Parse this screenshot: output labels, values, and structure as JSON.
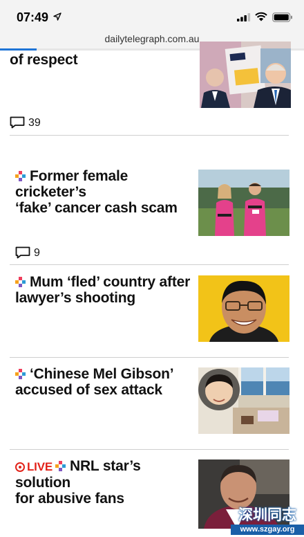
{
  "status_bar": {
    "time": "07:49"
  },
  "browser": {
    "url": "dailytelegraph.com.au",
    "load_progress": 0.12
  },
  "articles": [
    {
      "title_lines": [
        "of respect"
      ],
      "comments": "39",
      "thumb": "sports-montage"
    },
    {
      "title_lines": [
        "Former female cricketer’s",
        "‘fake’ cancer cash scam"
      ],
      "comments": "9",
      "thumb": "cricketers"
    },
    {
      "title_lines": [
        "Mum ‘fled’ country after",
        "lawyer’s shooting"
      ],
      "thumb": "smiling-man"
    },
    {
      "title_lines": [
        "‘Chinese Mel Gibson’",
        "accused of sex attack"
      ],
      "thumb": "mansion"
    },
    {
      "title_lines": [
        "NRL star’s solution",
        "for abusive fans"
      ],
      "live_label": "LIVE",
      "thumb": "nrl-player"
    }
  ],
  "watermark": {
    "main": "深圳同志",
    "sub": "www.szgay.org"
  }
}
